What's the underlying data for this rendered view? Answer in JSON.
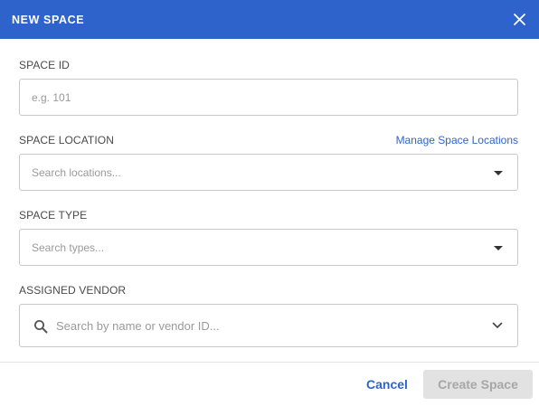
{
  "dialog": {
    "title": "NEW SPACE",
    "close_icon": "close-icon"
  },
  "fields": {
    "space_id": {
      "label": "SPACE ID",
      "placeholder": "e.g. 101",
      "value": ""
    },
    "space_location": {
      "label": "SPACE LOCATION",
      "link": "Manage Space Locations",
      "placeholder": "Search locations...",
      "value": "",
      "icon": "caret-down-icon"
    },
    "space_type": {
      "label": "SPACE TYPE",
      "placeholder": "Search types...",
      "value": "",
      "icon": "caret-down-icon"
    },
    "assigned_vendor": {
      "label": "ASSIGNED VENDOR",
      "placeholder": "Search by name or vendor ID...",
      "value": "",
      "icons": [
        "search-icon",
        "chevron-down-icon"
      ]
    }
  },
  "footer": {
    "cancel_label": "Cancel",
    "create_label": "Create Space",
    "create_disabled": true
  },
  "colors": {
    "header_bg": "#2f63cc",
    "link": "#2f63cc",
    "disabled_button_bg": "#e2e2e2",
    "disabled_button_text": "#a7a7a7"
  }
}
